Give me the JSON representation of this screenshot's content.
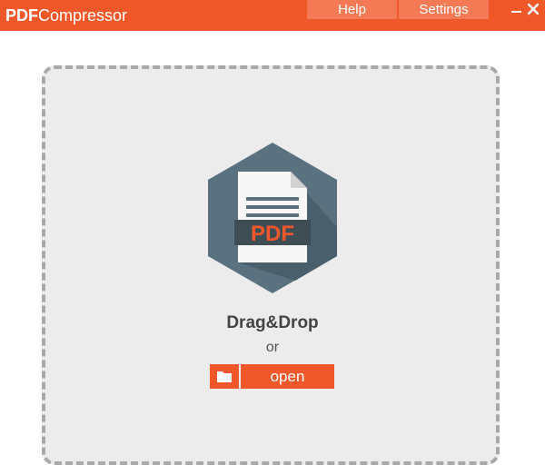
{
  "app": {
    "title_bold": "PDF",
    "title_light": "Compressor"
  },
  "menu": {
    "help": "Help",
    "settings": "Settings"
  },
  "window_controls": {
    "minimize_icon": "minimize-icon",
    "close_icon": "close-icon"
  },
  "dropzone": {
    "icon": "pdf-file-icon",
    "icon_label": "PDF",
    "drag_text": "Drag&Drop",
    "or_text": "or",
    "open_label": "open",
    "open_icon": "folder-icon"
  },
  "colors": {
    "accent": "#f0582a",
    "menu_button": "#f47a55",
    "dropzone_bg": "#ececec",
    "dropzone_border": "#a8a8a8",
    "hex": "#5a7180"
  }
}
